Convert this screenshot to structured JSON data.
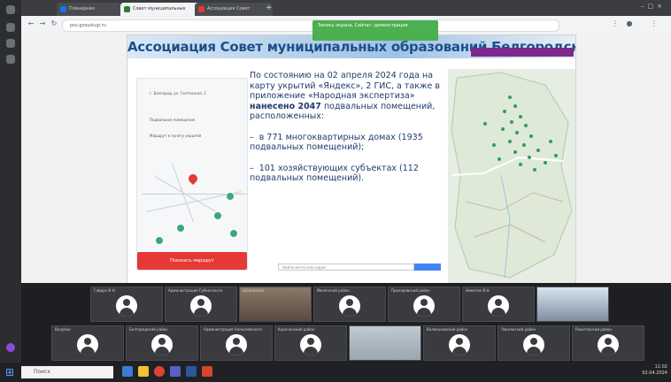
{
  "browser": {
    "tabs": [
      {
        "label": "Пленарная"
      },
      {
        "label": "Совет муниципальных"
      },
      {
        "label": "Ассоциация Совет"
      }
    ],
    "address": "pos.gosuslugi.ru",
    "notice": "Запись экрана, Сейчас: демонстрация"
  },
  "slide": {
    "title": "Ассоциация Совет муниципальных образований Белгородской области",
    "paragraph1_pre": "По состоянию на 02 апреля 2024 года на карту укрытий «Яндекс», 2 ГИС, а также в приложение «Народная экспертиза»",
    "paragraph1_bold": "нанесено 2047",
    "paragraph1_post": "подвальных помещений, расположенных:",
    "bullet1": "в 771 многоквартирных домах (1935 подвальных помещений);",
    "bullet2": "101 хозяйствующих субъектах (112 подвальных помещений).",
    "map_button": "Показать маршрут",
    "search_placeholder": "Найти место или адрес"
  },
  "participants": [
    {
      "name": "Гайдук И.Н."
    },
    {
      "name": "Администрация Губкинского"
    },
    {
      "name": "Шаповалов"
    },
    {
      "name": "Ивнянский район"
    },
    {
      "name": "Прохоровский район"
    },
    {
      "name": "Никитин В.Н."
    },
    {
      "name": ""
    },
    {
      "name": "Валуйки"
    },
    {
      "name": "Белгородский район"
    },
    {
      "name": "Администрация Алексеевского"
    },
    {
      "name": "Корочанский район"
    },
    {
      "name": "Красненский район"
    },
    {
      "name": "Волоконовский район"
    },
    {
      "name": "Чернянский район"
    },
    {
      "name": "Ракитянский район"
    }
  ],
  "taskbar": {
    "search_placeholder": "Поиск",
    "time": "11:02",
    "date": "02.04.2024"
  }
}
